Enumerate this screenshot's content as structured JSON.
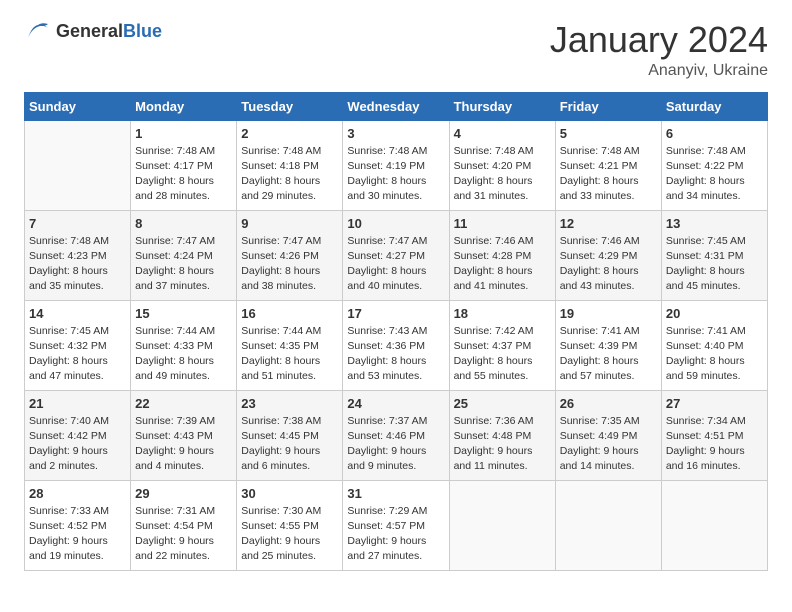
{
  "logo": {
    "general": "General",
    "blue": "Blue"
  },
  "header": {
    "month": "January 2024",
    "location": "Ananyiv, Ukraine"
  },
  "weekdays": [
    "Sunday",
    "Monday",
    "Tuesday",
    "Wednesday",
    "Thursday",
    "Friday",
    "Saturday"
  ],
  "weeks": [
    [
      {
        "day": "",
        "content": ""
      },
      {
        "day": "1",
        "content": "Sunrise: 7:48 AM\nSunset: 4:17 PM\nDaylight: 8 hours\nand 28 minutes."
      },
      {
        "day": "2",
        "content": "Sunrise: 7:48 AM\nSunset: 4:18 PM\nDaylight: 8 hours\nand 29 minutes."
      },
      {
        "day": "3",
        "content": "Sunrise: 7:48 AM\nSunset: 4:19 PM\nDaylight: 8 hours\nand 30 minutes."
      },
      {
        "day": "4",
        "content": "Sunrise: 7:48 AM\nSunset: 4:20 PM\nDaylight: 8 hours\nand 31 minutes."
      },
      {
        "day": "5",
        "content": "Sunrise: 7:48 AM\nSunset: 4:21 PM\nDaylight: 8 hours\nand 33 minutes."
      },
      {
        "day": "6",
        "content": "Sunrise: 7:48 AM\nSunset: 4:22 PM\nDaylight: 8 hours\nand 34 minutes."
      }
    ],
    [
      {
        "day": "7",
        "content": "Sunrise: 7:48 AM\nSunset: 4:23 PM\nDaylight: 8 hours\nand 35 minutes."
      },
      {
        "day": "8",
        "content": "Sunrise: 7:47 AM\nSunset: 4:24 PM\nDaylight: 8 hours\nand 37 minutes."
      },
      {
        "day": "9",
        "content": "Sunrise: 7:47 AM\nSunset: 4:26 PM\nDaylight: 8 hours\nand 38 minutes."
      },
      {
        "day": "10",
        "content": "Sunrise: 7:47 AM\nSunset: 4:27 PM\nDaylight: 8 hours\nand 40 minutes."
      },
      {
        "day": "11",
        "content": "Sunrise: 7:46 AM\nSunset: 4:28 PM\nDaylight: 8 hours\nand 41 minutes."
      },
      {
        "day": "12",
        "content": "Sunrise: 7:46 AM\nSunset: 4:29 PM\nDaylight: 8 hours\nand 43 minutes."
      },
      {
        "day": "13",
        "content": "Sunrise: 7:45 AM\nSunset: 4:31 PM\nDaylight: 8 hours\nand 45 minutes."
      }
    ],
    [
      {
        "day": "14",
        "content": "Sunrise: 7:45 AM\nSunset: 4:32 PM\nDaylight: 8 hours\nand 47 minutes."
      },
      {
        "day": "15",
        "content": "Sunrise: 7:44 AM\nSunset: 4:33 PM\nDaylight: 8 hours\nand 49 minutes."
      },
      {
        "day": "16",
        "content": "Sunrise: 7:44 AM\nSunset: 4:35 PM\nDaylight: 8 hours\nand 51 minutes."
      },
      {
        "day": "17",
        "content": "Sunrise: 7:43 AM\nSunset: 4:36 PM\nDaylight: 8 hours\nand 53 minutes."
      },
      {
        "day": "18",
        "content": "Sunrise: 7:42 AM\nSunset: 4:37 PM\nDaylight: 8 hours\nand 55 minutes."
      },
      {
        "day": "19",
        "content": "Sunrise: 7:41 AM\nSunset: 4:39 PM\nDaylight: 8 hours\nand 57 minutes."
      },
      {
        "day": "20",
        "content": "Sunrise: 7:41 AM\nSunset: 4:40 PM\nDaylight: 8 hours\nand 59 minutes."
      }
    ],
    [
      {
        "day": "21",
        "content": "Sunrise: 7:40 AM\nSunset: 4:42 PM\nDaylight: 9 hours\nand 2 minutes."
      },
      {
        "day": "22",
        "content": "Sunrise: 7:39 AM\nSunset: 4:43 PM\nDaylight: 9 hours\nand 4 minutes."
      },
      {
        "day": "23",
        "content": "Sunrise: 7:38 AM\nSunset: 4:45 PM\nDaylight: 9 hours\nand 6 minutes."
      },
      {
        "day": "24",
        "content": "Sunrise: 7:37 AM\nSunset: 4:46 PM\nDaylight: 9 hours\nand 9 minutes."
      },
      {
        "day": "25",
        "content": "Sunrise: 7:36 AM\nSunset: 4:48 PM\nDaylight: 9 hours\nand 11 minutes."
      },
      {
        "day": "26",
        "content": "Sunrise: 7:35 AM\nSunset: 4:49 PM\nDaylight: 9 hours\nand 14 minutes."
      },
      {
        "day": "27",
        "content": "Sunrise: 7:34 AM\nSunset: 4:51 PM\nDaylight: 9 hours\nand 16 minutes."
      }
    ],
    [
      {
        "day": "28",
        "content": "Sunrise: 7:33 AM\nSunset: 4:52 PM\nDaylight: 9 hours\nand 19 minutes."
      },
      {
        "day": "29",
        "content": "Sunrise: 7:31 AM\nSunset: 4:54 PM\nDaylight: 9 hours\nand 22 minutes."
      },
      {
        "day": "30",
        "content": "Sunrise: 7:30 AM\nSunset: 4:55 PM\nDaylight: 9 hours\nand 25 minutes."
      },
      {
        "day": "31",
        "content": "Sunrise: 7:29 AM\nSunset: 4:57 PM\nDaylight: 9 hours\nand 27 minutes."
      },
      {
        "day": "",
        "content": ""
      },
      {
        "day": "",
        "content": ""
      },
      {
        "day": "",
        "content": ""
      }
    ]
  ]
}
